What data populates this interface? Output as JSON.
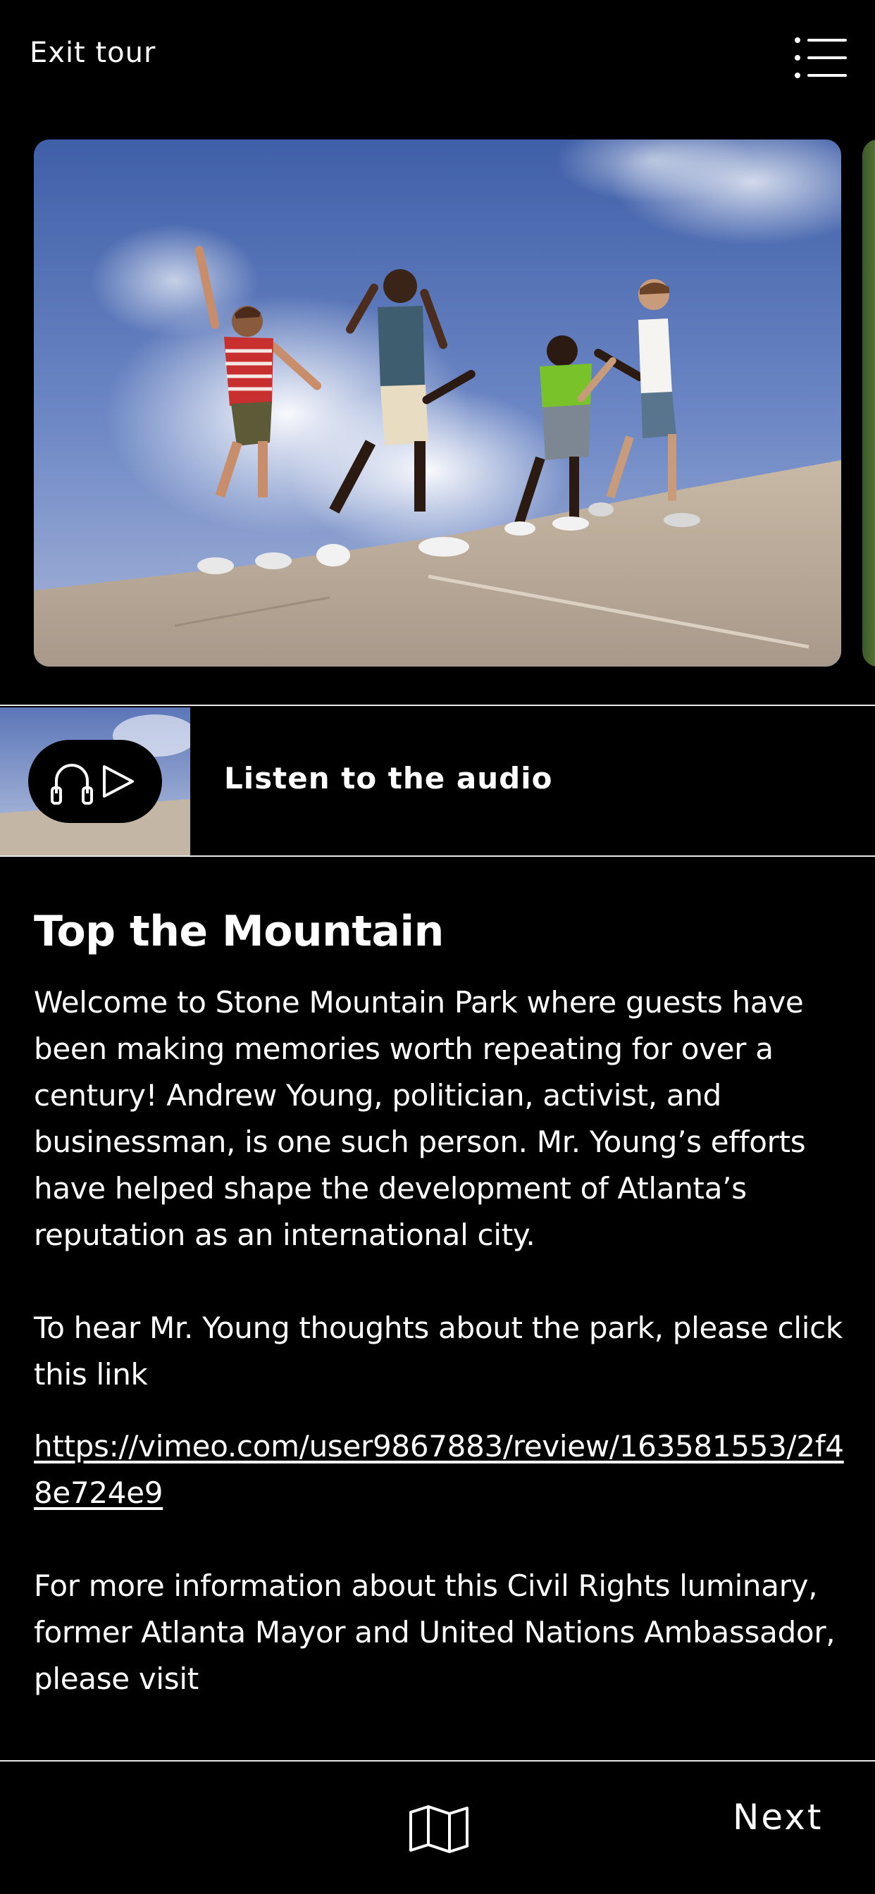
{
  "header": {
    "exit_label": "Exit tour",
    "menu_icon": "list-menu-icon"
  },
  "carousel": {
    "current_image": "kids-walking-on-rock-photo"
  },
  "audio": {
    "label": "Listen to the audio",
    "icons": [
      "headphones-icon",
      "play-icon"
    ]
  },
  "stop": {
    "title": "Top the Mountain",
    "paragraph_1": "Welcome to Stone Mountain Park where guests have been making memories worth repeating for over a century! Andrew Young, politician, activist, and businessman, is one such person. Mr. Young’s efforts have helped shape the development of Atlanta’s reputation as an international city.",
    "paragraph_2": "To hear Mr. Young thoughts about the park, please click this link",
    "link": "https://vimeo.com/user9867883/review/163581553/2f48e724e9",
    "paragraph_3": "For more information about this Civil Rights luminary, former Atlanta Mayor and United Nations Ambassador, please visit"
  },
  "footer": {
    "map_icon": "map-icon",
    "next_label": "Next"
  },
  "colors": {
    "background": "#000000",
    "text": "#ffffff",
    "divider": "#e8e8e8"
  }
}
